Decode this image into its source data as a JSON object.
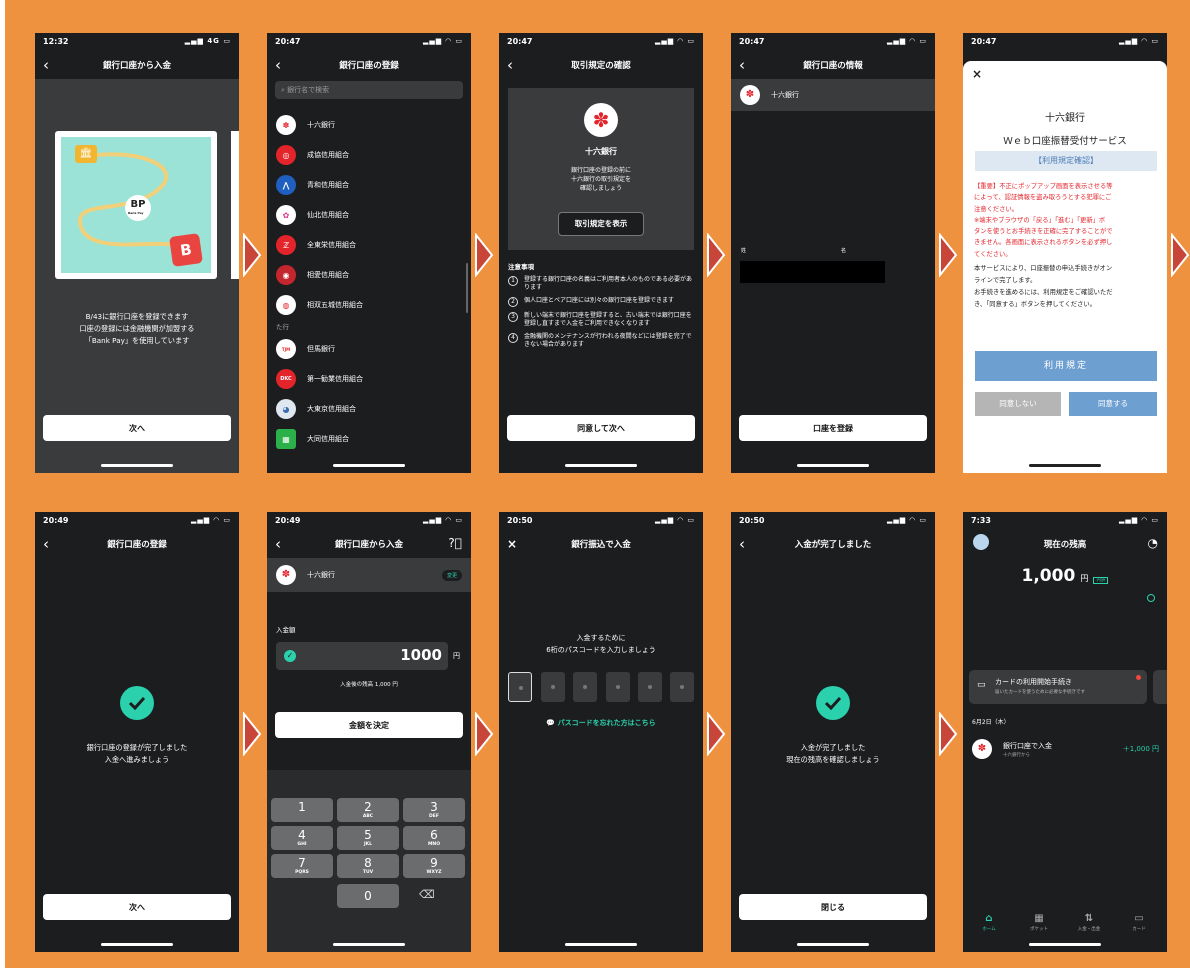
{
  "status": {
    "s1": "12:32",
    "s2": "20:47",
    "s3": "20:47",
    "s4": "20:47",
    "s5": "20:47",
    "s6": "20:49",
    "s7": "20:49",
    "s8": "20:50",
    "s9": "20:50",
    "s10": "7:33",
    "sig1": "4G"
  },
  "s1": {
    "title": "銀行口座から入金",
    "brand": "Bank Pay",
    "logo_b": "B",
    "text": [
      "B/43に銀行口座を登録できます",
      "口座の登録には金融機関が加盟する",
      "「Bank Pay」を使用しています"
    ],
    "button": "次へ"
  },
  "s2": {
    "title": "銀行口座の登録",
    "search_placeholder": "銀行名で検索",
    "banks": [
      "十六銀行",
      "成協信用組合",
      "青和信用組合",
      "仙北信用組合",
      "全東栄信用組合",
      "相愛信用組合",
      "相双五城信用組合"
    ],
    "section": "た行",
    "banks2": [
      "但馬銀行",
      "第一勧業信用組合",
      "大東京信用組合",
      "大同信用組合"
    ],
    "logo_dkc": "DKC"
  },
  "s3": {
    "title": "取引規定の確認",
    "bank": "十六銀行",
    "desc": [
      "銀行口座の登録の前に",
      "十六銀行の取引規定を",
      "確認しましょう"
    ],
    "show_button": "取引規定を表示",
    "notes_title": "注意事項",
    "notes": [
      {
        "n": "1",
        "t": "登録する銀行口座の名義はご利用者本人のものである必要があります"
      },
      {
        "n": "2",
        "t": "個人口座とペア口座には別々の銀行口座を登録できます"
      },
      {
        "n": "3",
        "t": "新しい端末で銀行口座を登録すると、古い端末では銀行口座を登録し直すまで入金をご利用できなくなります"
      },
      {
        "n": "4",
        "t": "金融機関のメンテナンスが行われる夜間などには登録を完了できない場合があります"
      }
    ],
    "button": "同意して次へ"
  },
  "s4": {
    "title": "銀行口座の情報",
    "bank": "十六銀行",
    "label_sei": "姓",
    "label_mei": "名",
    "button": "口座を登録"
  },
  "s5": {
    "close": "×",
    "bank": "十六銀行",
    "service": "Ｗｅｂ口座振替受付サービス",
    "terms_header": "【利用規定確認】",
    "warning": [
      "【重要】不正にポップアップ画面を表示させる等",
      "によって、認証情報を盗み取ろうとする犯罪にご",
      "注意ください。",
      "※端末やブラウザの「戻る」「進む」「更新」ボ",
      "タンを使うとお手続きを正確に完了することがで",
      "きません。各画面に表示されるボタンを必ず押し",
      "てください。"
    ],
    "info": [
      "本サービスにより、口座振替の申込手続きがオン",
      "ラインで完了します。",
      "お手続きを進めるには、利用規定をご確認いただ",
      "き、「同意する」ボタンを押してください。"
    ],
    "terms_button": "利用規定",
    "disagree": "同意しない",
    "agree": "同意する"
  },
  "s6": {
    "title": "銀行口座の登録",
    "text": [
      "銀行口座の登録が完了しました",
      "入金へ進みましょう"
    ],
    "button": "次へ"
  },
  "s7": {
    "title": "銀行口座から入金",
    "bank": "十六銀行",
    "change": "変更",
    "amount_label": "入金額",
    "amount": "1000",
    "unit": "円",
    "balance_after": "入金後の残高 1,000 円",
    "confirm": "金額を決定",
    "keys": [
      {
        "d": "1",
        "l": ""
      },
      {
        "d": "2",
        "l": "ABC"
      },
      {
        "d": "3",
        "l": "DEF"
      },
      {
        "d": "4",
        "l": "GHI"
      },
      {
        "d": "5",
        "l": "JKL"
      },
      {
        "d": "6",
        "l": "MNO"
      },
      {
        "d": "7",
        "l": "PQRS"
      },
      {
        "d": "8",
        "l": "TUV"
      },
      {
        "d": "9",
        "l": "WXYZ"
      }
    ],
    "zero": "0",
    "del": "⌫"
  },
  "s8": {
    "close": "×",
    "title": "銀行振込で入金",
    "text": [
      "入金するために",
      "6桁のパスコードを入力しましょう"
    ],
    "forgot": "パスコードを忘れた方はこちら"
  },
  "s9": {
    "title": "入金が完了しました",
    "text": [
      "入金が完了しました",
      "現在の残高を確認しましょう"
    ],
    "button": "閉じる"
  },
  "s10": {
    "title": "現在の残高",
    "balance": "1,000",
    "unit": "円",
    "badge": "内訳",
    "card_title": "カードの利用開始手続き",
    "card_sub": "届いたカードを使うために必要な手続きです",
    "date": "6月2日（木）",
    "tx_title": "銀行口座で入金",
    "tx_sub": "十六銀行から",
    "tx_amount": "＋1,000 円",
    "tabs": [
      "ホーム",
      "ポケット",
      "入金・出金",
      "カード"
    ]
  },
  "colors": {
    "accent": "#2bd1ad",
    "bank_red": "#e3242b",
    "orange": "#ef923f",
    "terms_blue": "#6d9fd0"
  }
}
